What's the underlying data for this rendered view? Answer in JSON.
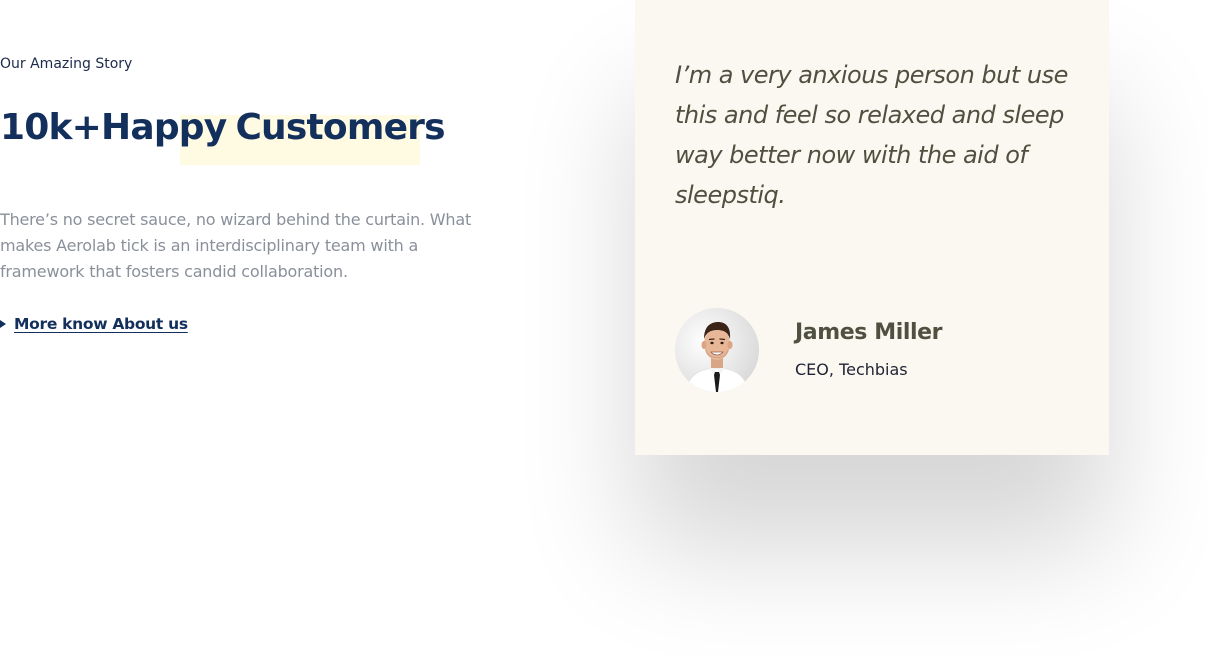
{
  "story": {
    "eyebrow": "Our Amazing Story",
    "headline_part1": "10k+Happy",
    "headline_part2": "Customers",
    "description": "There’s no secret sauce, no wizard behind the curtain. What makes Aerolab tick is an interdisciplinary team with a framework that fosters candid collaboration.",
    "link_label": "More know About us",
    "link_icon": "play-triangle-icon"
  },
  "testimonial": {
    "quote": "I’m a very anxious person but use this and feel so relaxed and sleep way better now with the aid of sleepstiq.",
    "author_name": "James Miller",
    "author_role": "CEO, Techbias",
    "avatar_icon": "person-avatar"
  },
  "colors": {
    "navy": "#132f5c",
    "highlight": "#fffbe3",
    "card_bg": "#fbf8f1",
    "quote_text": "#4f5040",
    "body_text": "#8a909a"
  }
}
